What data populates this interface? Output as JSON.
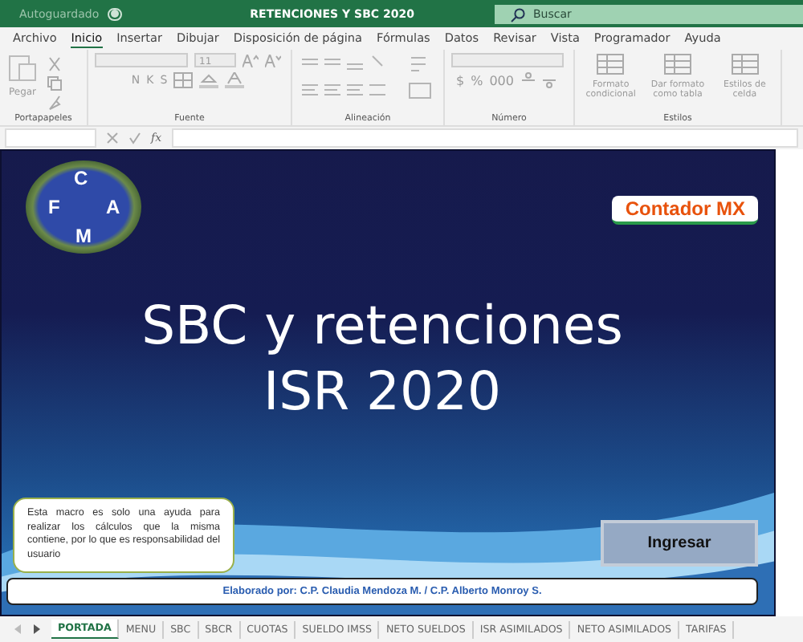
{
  "title_bar": {
    "autosave_label": "Autoguardado",
    "autosave_on": false,
    "file_title": "RETENCIONES Y SBC 2020",
    "search_placeholder": "Buscar"
  },
  "menu_tabs": [
    {
      "label": "Archivo",
      "selected": false
    },
    {
      "label": "Inicio",
      "selected": true
    },
    {
      "label": "Insertar",
      "selected": false
    },
    {
      "label": "Dibujar",
      "selected": false
    },
    {
      "label": "Disposición de página",
      "selected": false
    },
    {
      "label": "Fórmulas",
      "selected": false
    },
    {
      "label": "Datos",
      "selected": false
    },
    {
      "label": "Revisar",
      "selected": false
    },
    {
      "label": "Vista",
      "selected": false
    },
    {
      "label": "Programador",
      "selected": false
    },
    {
      "label": "Ayuda",
      "selected": false
    }
  ],
  "ribbon": {
    "groups": [
      {
        "kind": "clipboard",
        "name": "Portapapeles",
        "buttons": [
          "Pegar"
        ]
      },
      {
        "kind": "font",
        "name": "Fuente",
        "font_size": "11",
        "format_letters": [
          "N",
          "K",
          "S"
        ]
      },
      {
        "kind": "align",
        "name": "Alineación"
      },
      {
        "kind": "number",
        "name": "Número",
        "symbols": [
          "$",
          "%",
          "000"
        ]
      },
      {
        "kind": "styles",
        "name": "Estilos",
        "buttons": [
          "Formato condicional",
          "Dar formato como tabla",
          "Estilos de celda"
        ]
      }
    ]
  },
  "formula_bar": {
    "function_label": "fx"
  },
  "sheet": {
    "logo_letters": [
      "C",
      "F",
      "A",
      "M"
    ],
    "badge": "Contador MX",
    "title": "SBC y retenciones ISR 2020",
    "note": "Esta macro es solo una ayuda para realizar los cálculos que la misma contiene, por lo que es responsabilidad del usuario",
    "button": "Ingresar",
    "credits": "Elaborado por: C.P. Claudia Mendoza M. / C.P. Alberto Monroy S."
  },
  "sheet_tabs": [
    {
      "label": "PORTADA",
      "selected": true
    },
    {
      "label": "MENU",
      "selected": false
    },
    {
      "label": "SBC",
      "selected": false
    },
    {
      "label": "SBCR",
      "selected": false
    },
    {
      "label": "CUOTAS",
      "selected": false
    },
    {
      "label": "SUELDO IMSS",
      "selected": false
    },
    {
      "label": "NETO SUELDOS",
      "selected": false
    },
    {
      "label": "ISR ASIMILADOS",
      "selected": false
    },
    {
      "label": "NETO ASIMILADOS",
      "selected": false
    },
    {
      "label": "TARIFAS",
      "selected": false
    }
  ]
}
